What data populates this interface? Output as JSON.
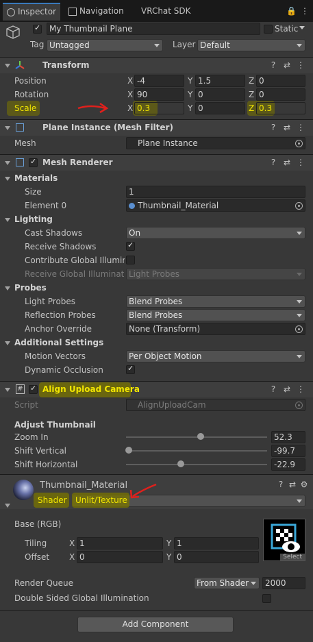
{
  "tabs": {
    "inspector": "Inspector",
    "navigation": "Navigation",
    "vrchat": "VRChat SDK"
  },
  "object": {
    "name": "My Thumbnail Plane",
    "static_label": "Static",
    "tag_label": "Tag",
    "tag_value": "Untagged",
    "layer_label": "Layer",
    "layer_value": "Default"
  },
  "transform": {
    "title": "Transform",
    "position_label": "Position",
    "rotation_label": "Rotation",
    "scale_label": "Scale",
    "axis_x": "X",
    "axis_y": "Y",
    "axis_z": "Z",
    "position": {
      "x": "-4",
      "y": "1.5",
      "z": "0"
    },
    "rotation": {
      "x": "90",
      "y": "0",
      "z": "0"
    },
    "scale": {
      "x": "0.3",
      "y": "0",
      "z": "0.3"
    }
  },
  "mesh_filter": {
    "title": "Plane Instance (Mesh Filter)",
    "mesh_label": "Mesh",
    "mesh_value": "Plane Instance"
  },
  "mesh_renderer": {
    "title": "Mesh Renderer",
    "materials": "Materials",
    "size_label": "Size",
    "size_value": "1",
    "element0_label": "Element 0",
    "element0_value": "Thumbnail_Material",
    "lighting": "Lighting",
    "cast_shadows_label": "Cast Shadows",
    "cast_shadows_value": "On",
    "receive_shadows_label": "Receive Shadows",
    "contrib_gi_label": "Contribute Global Illuminati",
    "receive_gi_label": "Receive Global Illuminatio",
    "receive_gi_value": "Light Probes",
    "probes": "Probes",
    "light_probes_label": "Light Probes",
    "light_probes_value": "Blend Probes",
    "reflection_probes_label": "Reflection Probes",
    "reflection_probes_value": "Blend Probes",
    "anchor_label": "Anchor Override",
    "anchor_value": "None (Transform)",
    "additional": "Additional Settings",
    "motion_label": "Motion Vectors",
    "motion_value": "Per Object Motion",
    "dynamic_label": "Dynamic Occlusion"
  },
  "align": {
    "title": "Align Upload Camera",
    "script_label": "Script",
    "script_value": "AlignUploadCam",
    "adjust": "Adjust Thumbnail",
    "zoom_label": "Zoom In",
    "zoom_value": "52.3",
    "zoom_frac": 0.53,
    "shiftv_label": "Shift Vertical",
    "shiftv_value": "-99.7",
    "shiftv_frac": 0.02,
    "shifth_label": "Shift Horizontal",
    "shifth_value": "-22.9",
    "shifth_frac": 0.39
  },
  "material": {
    "name": "Thumbnail_Material",
    "shader_label": "Shader",
    "shader_value": "Unlit/Texture",
    "base_label": "Base (RGB)",
    "tiling_label": "Tiling",
    "offset_label": "Offset",
    "tiling": {
      "x": "1",
      "y": "1"
    },
    "offset": {
      "x": "0",
      "y": "0"
    },
    "select_label": "Select",
    "render_queue_label": "Render Queue",
    "render_queue_mode": "From Shader",
    "render_queue_value": "2000",
    "double_sided_label": "Double Sided Global Illumination"
  },
  "add_component": "Add Component",
  "colors": {
    "accent": "#3a79bb",
    "highlight": "#f2e600",
    "arrow": "#e0201c"
  }
}
